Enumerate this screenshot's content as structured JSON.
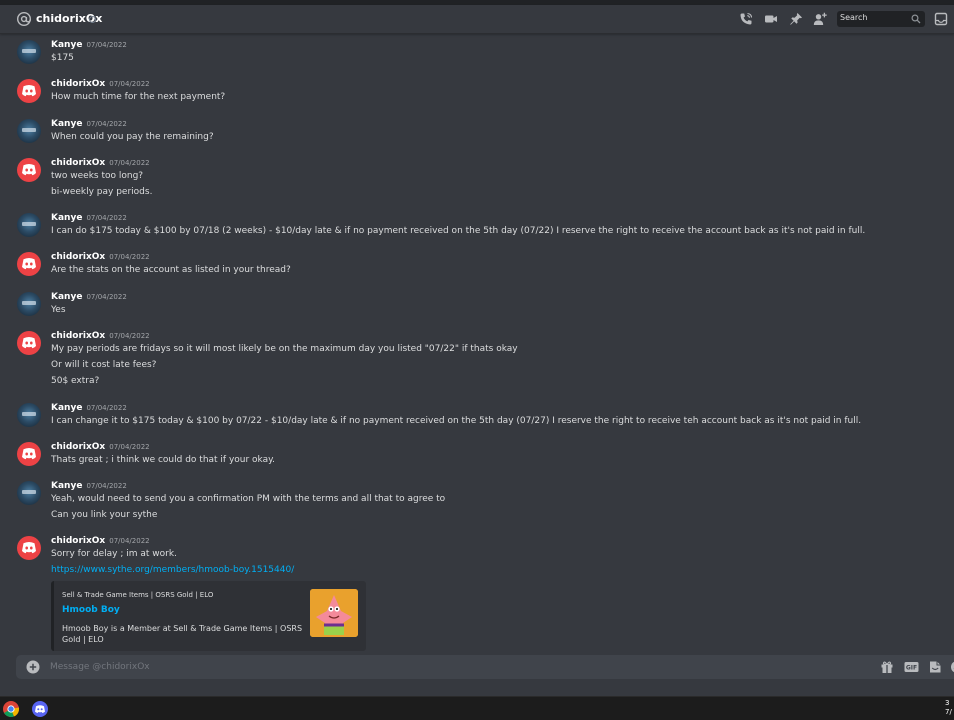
{
  "header": {
    "channel_name": "chidorixOx",
    "search_placeholder": "Search"
  },
  "messages": [
    {
      "author": "Kanye",
      "timestamp": "07/04/2022",
      "avatar": "kanye-avatar",
      "lines": [
        "$175"
      ]
    },
    {
      "author": "chidorixOx",
      "timestamp": "07/04/2022",
      "avatar": "discord-default-avatar",
      "lines": [
        "How much time for the next payment?"
      ]
    },
    {
      "author": "Kanye",
      "timestamp": "07/04/2022",
      "avatar": "kanye-avatar",
      "lines": [
        "When could you pay the remaining?"
      ]
    },
    {
      "author": "chidorixOx",
      "timestamp": "07/04/2022",
      "avatar": "discord-default-avatar",
      "lines": [
        "two weeks too long?",
        "bi-weekly pay periods."
      ]
    },
    {
      "author": "Kanye",
      "timestamp": "07/04/2022",
      "avatar": "kanye-avatar",
      "lines": [
        "I can do $175 today & $100 by 07/18 (2 weeks) - $10/day late & if no payment received on the 5th day (07/22) I reserve the right to receive the account back as it's not paid in full."
      ]
    },
    {
      "author": "chidorixOx",
      "timestamp": "07/04/2022",
      "avatar": "discord-default-avatar",
      "lines": [
        "Are the stats on the account as listed in your thread?"
      ]
    },
    {
      "author": "Kanye",
      "timestamp": "07/04/2022",
      "avatar": "kanye-avatar",
      "lines": [
        "Yes"
      ]
    },
    {
      "author": "chidorixOx",
      "timestamp": "07/04/2022",
      "avatar": "discord-default-avatar",
      "lines": [
        "My pay periods are fridays so it will most likely be on the maximum day you listed \"07/22\" if thats okay",
        "Or will it cost late fees?",
        "50$ extra?"
      ]
    },
    {
      "author": "Kanye",
      "timestamp": "07/04/2022",
      "avatar": "kanye-avatar",
      "lines": [
        "I can change it to $175 today & $100 by 07/22 - $10/day late & if no payment received on the 5th day (07/27) I reserve the right to receive teh account back as it's not paid in full."
      ]
    },
    {
      "author": "chidorixOx",
      "timestamp": "07/04/2022",
      "avatar": "discord-default-avatar",
      "lines": [
        "Thats great ; i think we could do that if your okay."
      ]
    },
    {
      "author": "Kanye",
      "timestamp": "07/04/2022",
      "avatar": "kanye-avatar",
      "lines": [
        "Yeah, would need to send you a confirmation PM with the terms and all that to agree to",
        "Can you link your sythe"
      ]
    },
    {
      "author": "chidorixOx",
      "timestamp": "07/04/2022",
      "avatar": "discord-default-avatar",
      "lines": [
        "Sorry for delay ; im at work."
      ],
      "link": "https://www.sythe.org/members/hmoob-boy.1515440/"
    }
  ],
  "embed": {
    "site": "Sell & Trade Game Items | OSRS Gold | ELO",
    "title": "Hmoob Boy",
    "description": "Hmoob Boy is a Member at Sell & Trade Game Items | OSRS Gold | ELO"
  },
  "composer": {
    "placeholder": "Message @chidorixOx"
  },
  "taskbar": {
    "clock_line1": "3",
    "clock_line2": "7/"
  },
  "colors": {
    "background": "#36393f",
    "link": "#00aff4",
    "discord_red": "#ed4245",
    "embed_bg": "#2f3136",
    "composer_bg": "#40444b"
  }
}
